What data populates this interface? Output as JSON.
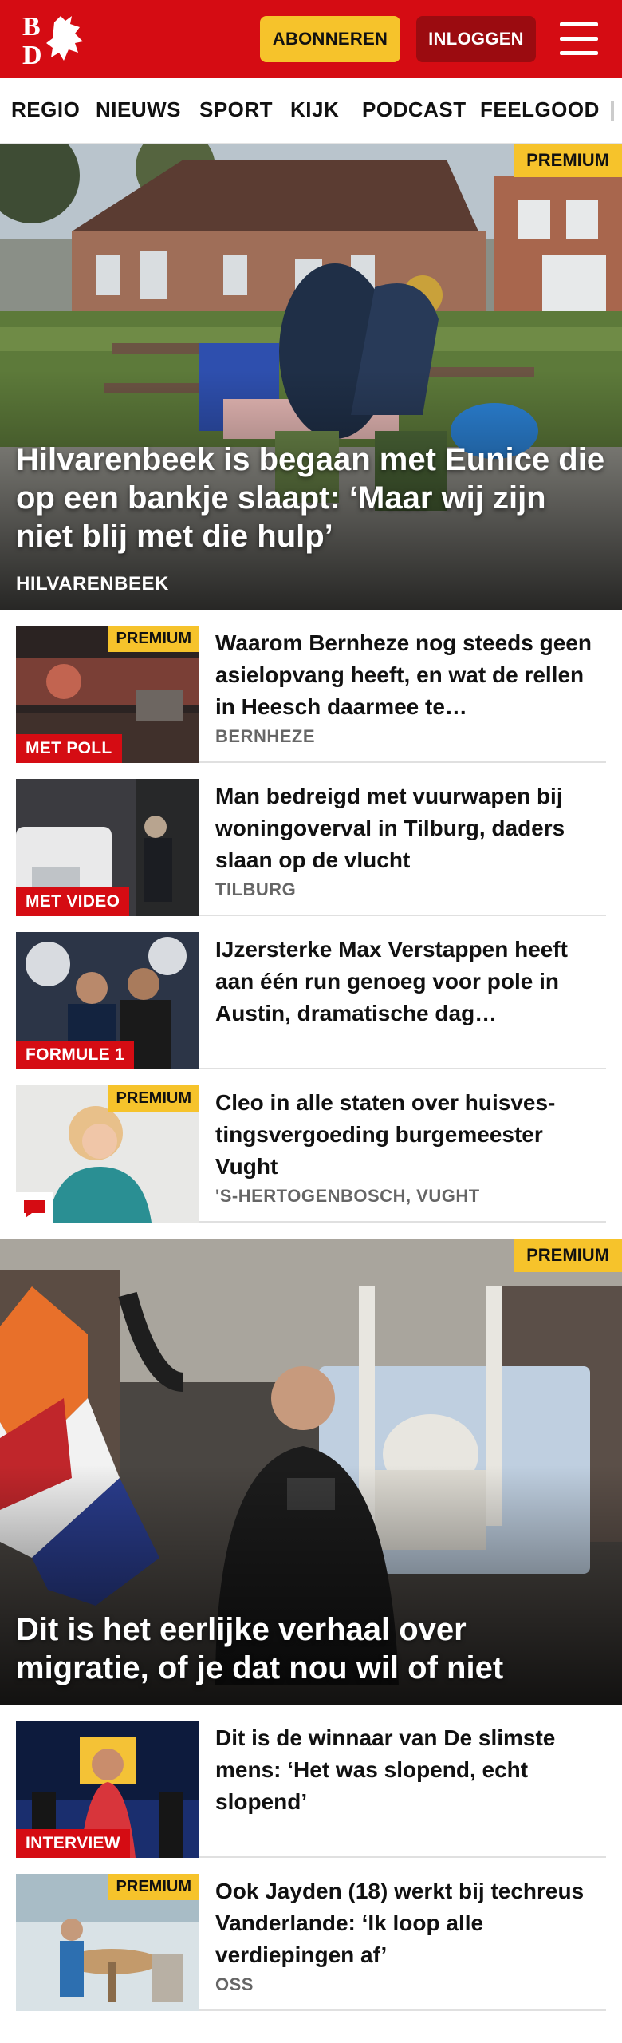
{
  "header": {
    "subscribe_label": "ABONNEREN",
    "login_label": "INLOGGEN",
    "brand_color": "#d50c13",
    "accent_color": "#f6c32b"
  },
  "nav": {
    "items": [
      "REGIO",
      "NIEUWS",
      "SPORT",
      "KIJK",
      "PODCAST",
      "FEELGOOD"
    ]
  },
  "hero1": {
    "badge": "PREMIUM",
    "title": "Hilvarenbeek is begaan met Eunice die op een bankje slaapt: ‘Maar wij zijn niet blij met die hulp’",
    "place": "HILVARENBEEK"
  },
  "articles": [
    {
      "badge": "PREMIUM",
      "label": "MET POLL",
      "title": "Waarom Bernheze nog steeds geen asielopvang heeft, en wat de rellen in Heesch daarmee te…",
      "place": "BERNHEZE"
    },
    {
      "label": "MET VIDEO",
      "title": "Man bedreigd met vuurwapen bij woningoverval in Tilburg, daders slaan op de vlucht",
      "place": "TILBURG"
    },
    {
      "label": "FORMULE 1",
      "title": "IJzersterke Max Verstappen heeft aan één run genoeg voor pole in Austin, dramatische dag…",
      "place": ""
    },
    {
      "badge": "PREMIUM",
      "icon": "comment-icon",
      "title": "Cleo in alle staten over huisves­tingsvergoeding burgemeester Vught",
      "place": "'S-HERTOGENBOSCH, VUGHT"
    }
  ],
  "hero2": {
    "badge": "PREMIUM",
    "title": "Dit is het eerlijke verhaal over migratie, of je dat nou wil of niet"
  },
  "articles2": [
    {
      "label": "INTERVIEW",
      "title": "Dit is de winnaar van De slimste mens: ‘Het was slopend, echt slopend’",
      "place": ""
    },
    {
      "badge": "PREMIUM",
      "title": "Ook Jayden (18) werkt bij techreus Vanderlande: ‘Ik loop alle verdiepingen af’",
      "place": "OSS"
    }
  ]
}
